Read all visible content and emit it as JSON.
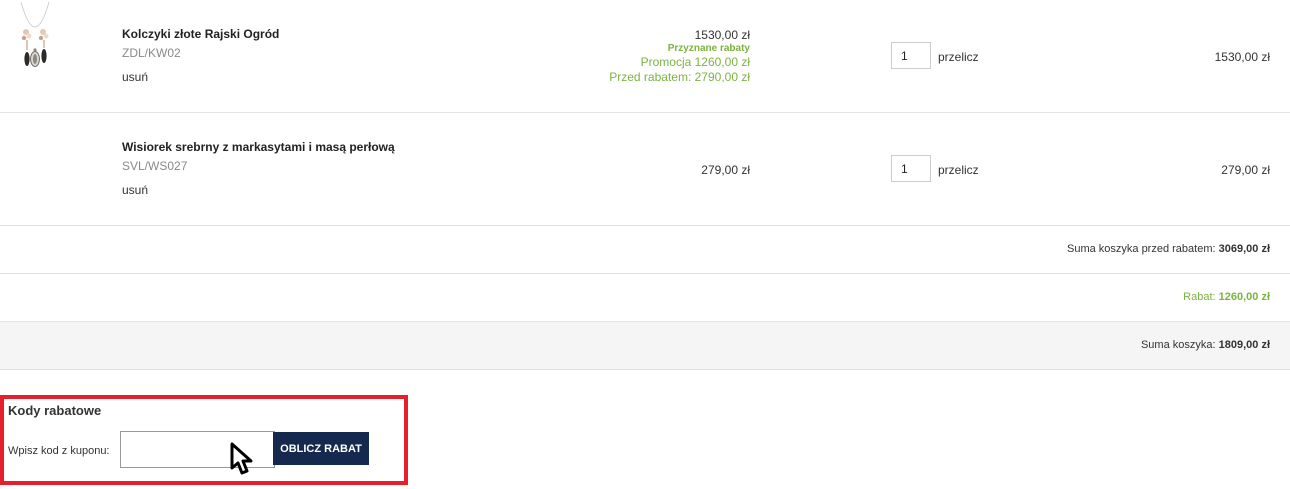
{
  "cart": {
    "items": [
      {
        "name": "Kolczyki złote Rajski Ogród",
        "sku": "ZDL/KW02",
        "remove_label": "usuń",
        "price": "1530,00 zł",
        "discount_title": "Przyznane rabaty",
        "promo_line": "Promocja 1260,00 zł",
        "before_discount_line": "Przed rabatem: 2790,00 zł",
        "qty": "1",
        "recalc_label": "przelicz",
        "total": "1530,00 zł",
        "image_icon": "earrings-product-image"
      },
      {
        "name": "Wisiorek srebrny z markasytami i masą perłową",
        "sku": "SVL/WS027",
        "remove_label": "usuń",
        "price": "279,00 zł",
        "qty": "1",
        "recalc_label": "przelicz",
        "total": "279,00 zł",
        "image_icon": "pendant-product-image"
      }
    ]
  },
  "summary": {
    "before_discount_label": "Suma koszyka przed rabatem:",
    "before_discount_value": "3069,00 zł",
    "discount_label": "Rabat:",
    "discount_value": "1260,00 zł",
    "total_label": "Suma koszyka:",
    "total_value": "1809,00 zł"
  },
  "coupon": {
    "title": "Kody rabatowe",
    "label": "Wpisz kod z kuponu:",
    "input_value": "",
    "button_label": "OBLICZ RABAT"
  },
  "colors": {
    "accent_green": "#7cb342",
    "button_navy": "#14294d",
    "highlight_red": "#e5202a"
  }
}
